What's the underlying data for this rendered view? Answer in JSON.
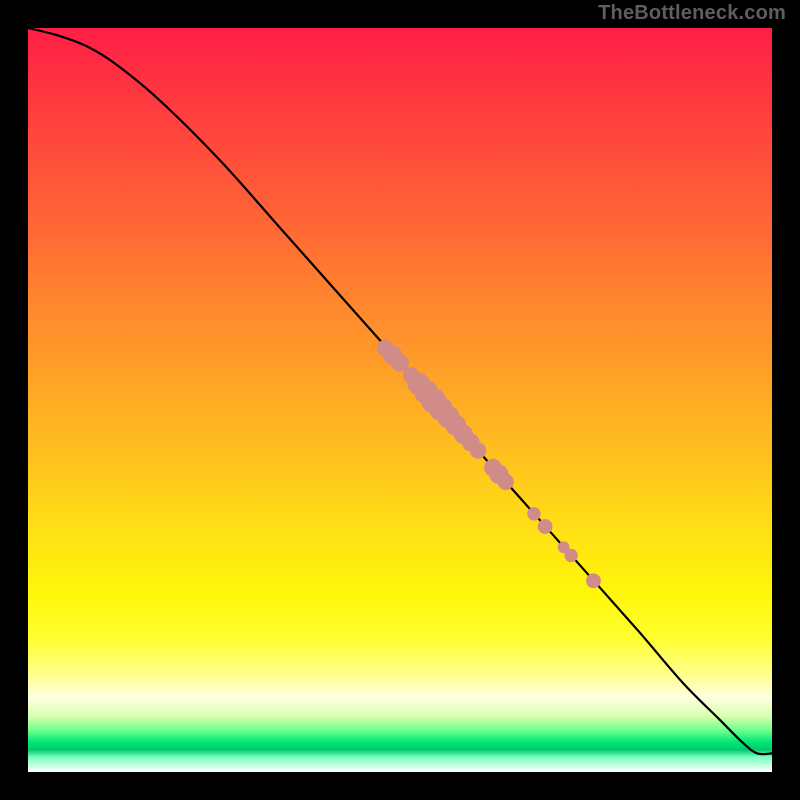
{
  "watermark": "TheBottleneck.com",
  "colors": {
    "dot": "#d18b88",
    "curve": "#000000",
    "frame": "#000000"
  },
  "chart_data": {
    "type": "line",
    "title": "",
    "xlabel": "",
    "ylabel": "",
    "xlim": [
      0,
      100
    ],
    "ylim": [
      0,
      100
    ],
    "grid": false,
    "legend": null,
    "series": [
      {
        "name": "curve",
        "x": [
          0,
          4,
          8,
          12,
          18,
          26,
          34,
          42,
          50,
          58,
          66,
          74,
          82,
          88,
          93,
          96,
          98,
          100
        ],
        "y": [
          100,
          99,
          97.5,
          95,
          90,
          82,
          73,
          64,
          55,
          46,
          37,
          28,
          19,
          12,
          7,
          4,
          2.5,
          2.5
        ]
      }
    ],
    "points": [
      {
        "x": 48,
        "y": 57.0,
        "r": 1.1
      },
      {
        "x": 49,
        "y": 56.0,
        "r": 1.3
      },
      {
        "x": 50,
        "y": 55.0,
        "r": 1.2
      },
      {
        "x": 51.5,
        "y": 53.3,
        "r": 1.1
      },
      {
        "x": 52.5,
        "y": 52.2,
        "r": 1.5
      },
      {
        "x": 53.5,
        "y": 51.1,
        "r": 1.6
      },
      {
        "x": 54.5,
        "y": 49.9,
        "r": 1.7
      },
      {
        "x": 55.5,
        "y": 48.8,
        "r": 1.6
      },
      {
        "x": 56.5,
        "y": 47.7,
        "r": 1.5
      },
      {
        "x": 57.5,
        "y": 46.6,
        "r": 1.4
      },
      {
        "x": 58.5,
        "y": 45.4,
        "r": 1.3
      },
      {
        "x": 59.5,
        "y": 44.3,
        "r": 1.2
      },
      {
        "x": 60.5,
        "y": 43.2,
        "r": 1.1
      },
      {
        "x": 62.5,
        "y": 40.9,
        "r": 1.2
      },
      {
        "x": 63.3,
        "y": 40.0,
        "r": 1.3
      },
      {
        "x": 64.2,
        "y": 39.0,
        "r": 1.1
      },
      {
        "x": 68.0,
        "y": 34.7,
        "r": 0.9
      },
      {
        "x": 69.5,
        "y": 33.0,
        "r": 1.0
      },
      {
        "x": 72.0,
        "y": 30.2,
        "r": 0.8
      },
      {
        "x": 73.0,
        "y": 29.1,
        "r": 0.9
      },
      {
        "x": 76.0,
        "y": 25.7,
        "r": 1.0
      }
    ]
  }
}
